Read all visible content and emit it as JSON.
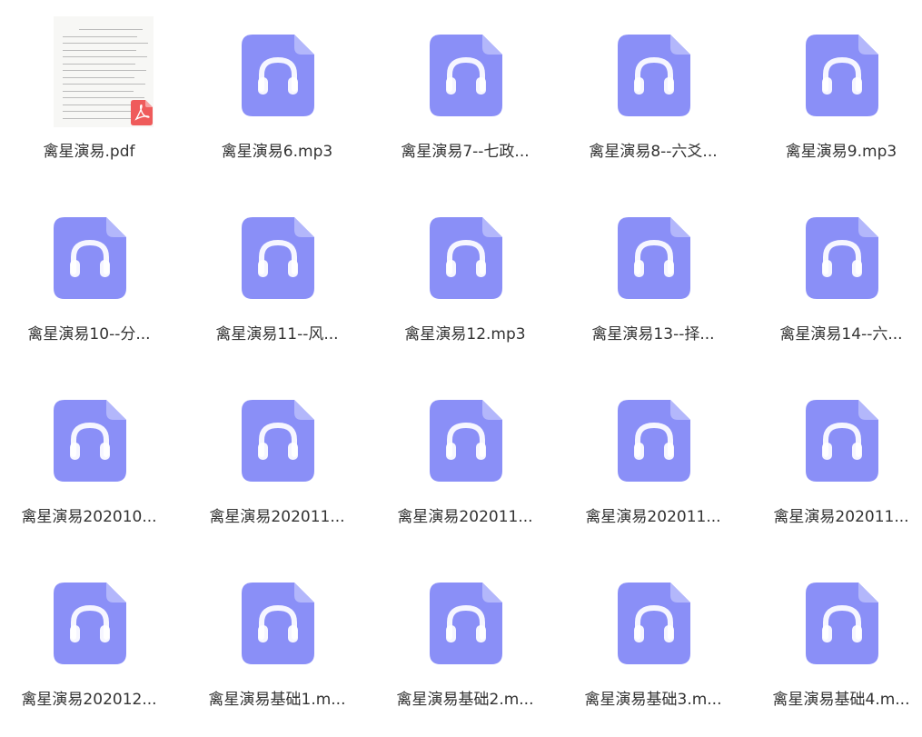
{
  "colors": {
    "audio_icon": "#8a8ff7",
    "audio_icon_fold": "#b3b7fb",
    "pdf_badge": "#ef5b5b",
    "label_text": "#333333"
  },
  "files": [
    {
      "label": "禽星演易.pdf",
      "type": "pdf",
      "icon": "pdf-document-icon"
    },
    {
      "label": "禽星演易6.mp3",
      "type": "audio",
      "icon": "headphones-icon"
    },
    {
      "label": "禽星演易7--七政...",
      "type": "audio",
      "icon": "headphones-icon"
    },
    {
      "label": "禽星演易8--六爻...",
      "type": "audio",
      "icon": "headphones-icon"
    },
    {
      "label": "禽星演易9.mp3",
      "type": "audio",
      "icon": "headphones-icon"
    },
    {
      "label": "禽星演易10--分...",
      "type": "audio",
      "icon": "headphones-icon"
    },
    {
      "label": "禽星演易11--风...",
      "type": "audio",
      "icon": "headphones-icon"
    },
    {
      "label": "禽星演易12.mp3",
      "type": "audio",
      "icon": "headphones-icon"
    },
    {
      "label": "禽星演易13--择...",
      "type": "audio",
      "icon": "headphones-icon"
    },
    {
      "label": "禽星演易14--六...",
      "type": "audio",
      "icon": "headphones-icon"
    },
    {
      "label": "禽星演易202010...",
      "type": "audio",
      "icon": "headphones-icon"
    },
    {
      "label": "禽星演易202011...",
      "type": "audio",
      "icon": "headphones-icon"
    },
    {
      "label": "禽星演易202011...",
      "type": "audio",
      "icon": "headphones-icon"
    },
    {
      "label": "禽星演易202011...",
      "type": "audio",
      "icon": "headphones-icon"
    },
    {
      "label": "禽星演易202011...",
      "type": "audio",
      "icon": "headphones-icon"
    },
    {
      "label": "禽星演易202012...",
      "type": "audio",
      "icon": "headphones-icon"
    },
    {
      "label": "禽星演易基础1.m...",
      "type": "audio",
      "icon": "headphones-icon"
    },
    {
      "label": "禽星演易基础2.m...",
      "type": "audio",
      "icon": "headphones-icon"
    },
    {
      "label": "禽星演易基础3.m...",
      "type": "audio",
      "icon": "headphones-icon"
    },
    {
      "label": "禽星演易基础4.m...",
      "type": "audio",
      "icon": "headphones-icon"
    }
  ]
}
